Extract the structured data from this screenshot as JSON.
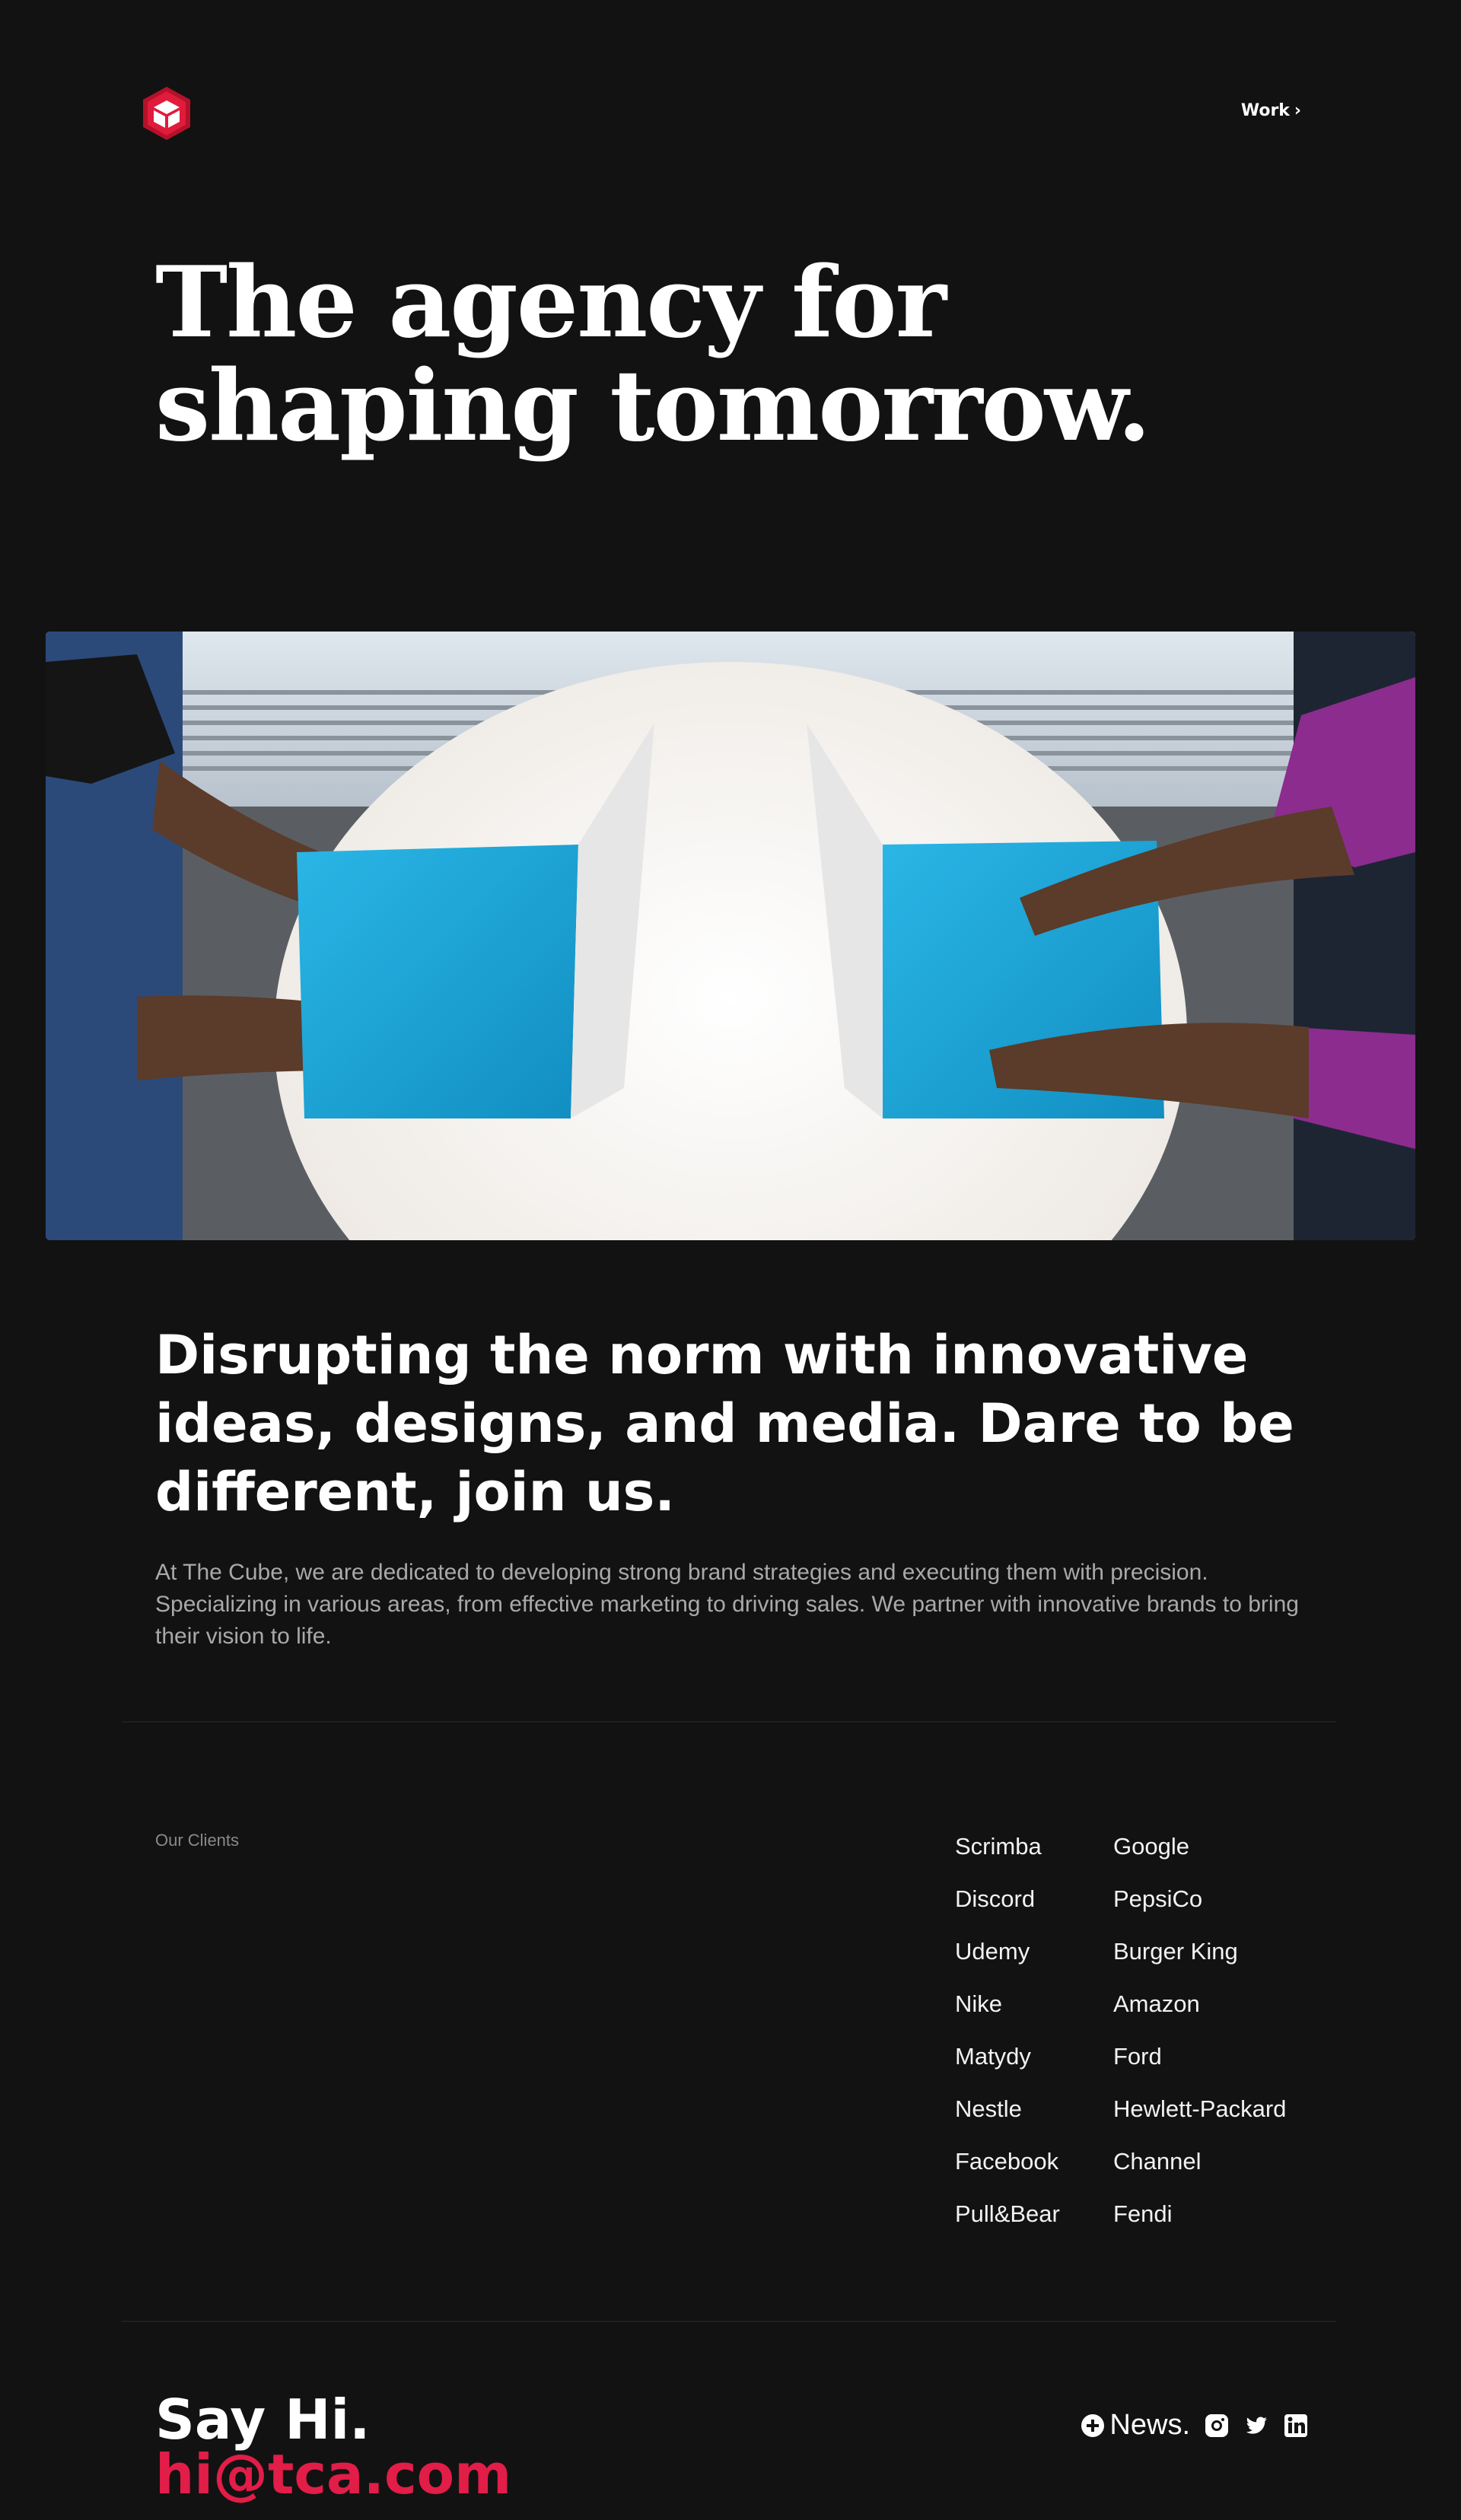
{
  "header": {
    "logo_icon": "cube-logo-icon",
    "nav_work_label": "Work",
    "nav_work_icon": "chevron-right-icon"
  },
  "hero": {
    "title_line1": "The agency for",
    "title_line2": "shaping tomorrow.",
    "image_icon": "laptops-photo"
  },
  "intro": {
    "heading": "Disrupting the norm with innovative ideas, designs, and media. Dare to be different, join us.",
    "text": "At The Cube, we are dedicated to developing strong brand strategies and executing them with precision. Specializing in various areas, from effective marketing to driving sales. We partner with innovative brands to bring their vision to life."
  },
  "clients": {
    "label": "Our Clients",
    "column_a": [
      "Scrimba",
      "Discord",
      "Udemy",
      "Nike",
      "Matydy",
      "Nestle",
      "Facebook",
      "Pull&Bear"
    ],
    "column_b": [
      "Google",
      "PepsiCo",
      "Burger King",
      "Amazon",
      "Ford",
      "Hewlett-Packard",
      "Channel",
      "Fendi"
    ]
  },
  "footer": {
    "say_hi": "Say Hi.",
    "email": "hi@tca.com",
    "news_label": "News.",
    "news_icon": "plus-circle-icon",
    "social_icons": [
      "instagram-icon",
      "twitter-icon",
      "linkedin-icon"
    ]
  },
  "colors": {
    "background": "#121212",
    "accent": "#e11d48",
    "text": "#ffffff",
    "muted": "#a9a9a9"
  }
}
